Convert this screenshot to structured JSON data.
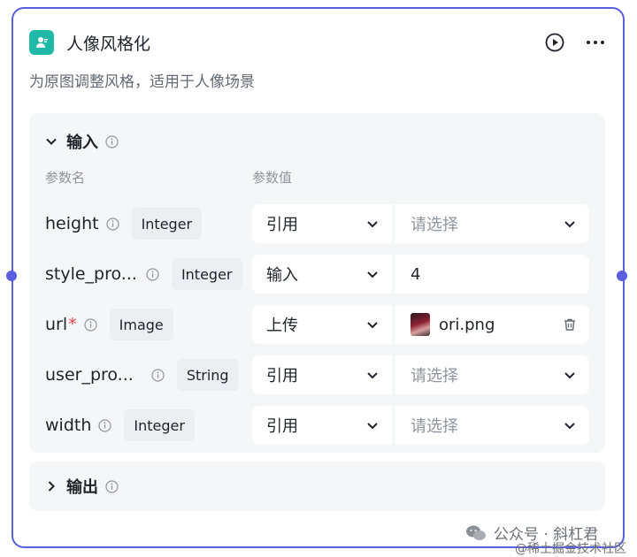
{
  "node": {
    "title": "人像风格化",
    "description": "为原图调整风格，适用于人像场景"
  },
  "input_section": {
    "title": "输入",
    "col_name": "参数名",
    "col_value": "参数值",
    "params": [
      {
        "name": "height",
        "required": false,
        "type": "Integer",
        "source": "引用",
        "value": "",
        "placeholder": "请选择"
      },
      {
        "name": "style_pro...",
        "required": false,
        "type": "Integer",
        "source": "输入",
        "value": "4",
        "placeholder": ""
      },
      {
        "name": "url",
        "required": true,
        "type": "Image",
        "source": "上传",
        "value": "ori.png",
        "placeholder": ""
      },
      {
        "name": "user_pro...",
        "required": false,
        "type": "String",
        "source": "引用",
        "value": "",
        "placeholder": "请选择"
      },
      {
        "name": "width",
        "required": false,
        "type": "Integer",
        "source": "引用",
        "value": "",
        "placeholder": "请选择"
      }
    ]
  },
  "output_section": {
    "title": "输出"
  },
  "watermark": {
    "line1": "公众号 · 斜杠君",
    "line2": "@稀土掘金技术社区"
  },
  "colors": {
    "accent": "#5a5ee0",
    "app_icon": "#1fb9a8",
    "panel_bg": "#f5f6f8",
    "required": "#e04545"
  },
  "icons": {
    "app": "user-icon",
    "run": "play-circle-icon",
    "more": "more-dots-icon",
    "collapse": "chevron-down-icon",
    "expand": "chevron-right-icon",
    "info": "info-icon",
    "delete": "trash-icon"
  }
}
